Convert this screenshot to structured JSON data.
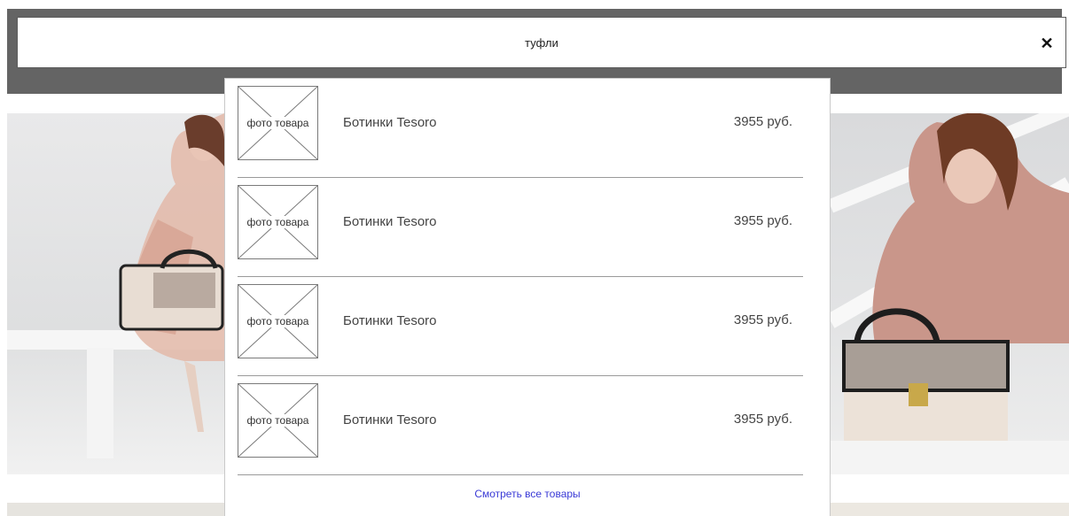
{
  "search": {
    "query": "туфли"
  },
  "results": [
    {
      "thumb_label": "фото товара",
      "name": "Ботинки Tesoro",
      "price": "3955 руб."
    },
    {
      "thumb_label": "фото товара",
      "name": "Ботинки Tesoro",
      "price": "3955 руб."
    },
    {
      "thumb_label": "фото товара",
      "name": "Ботинки Tesoro",
      "price": "3955 руб."
    },
    {
      "thumb_label": "фото товара",
      "name": "Ботинки Tesoro",
      "price": "3955 руб."
    }
  ],
  "see_all_label": "Смотреть все товары",
  "icons": {
    "close": "close-icon"
  },
  "colors": {
    "header_band": "#646464",
    "link": "#3a3ad6"
  }
}
